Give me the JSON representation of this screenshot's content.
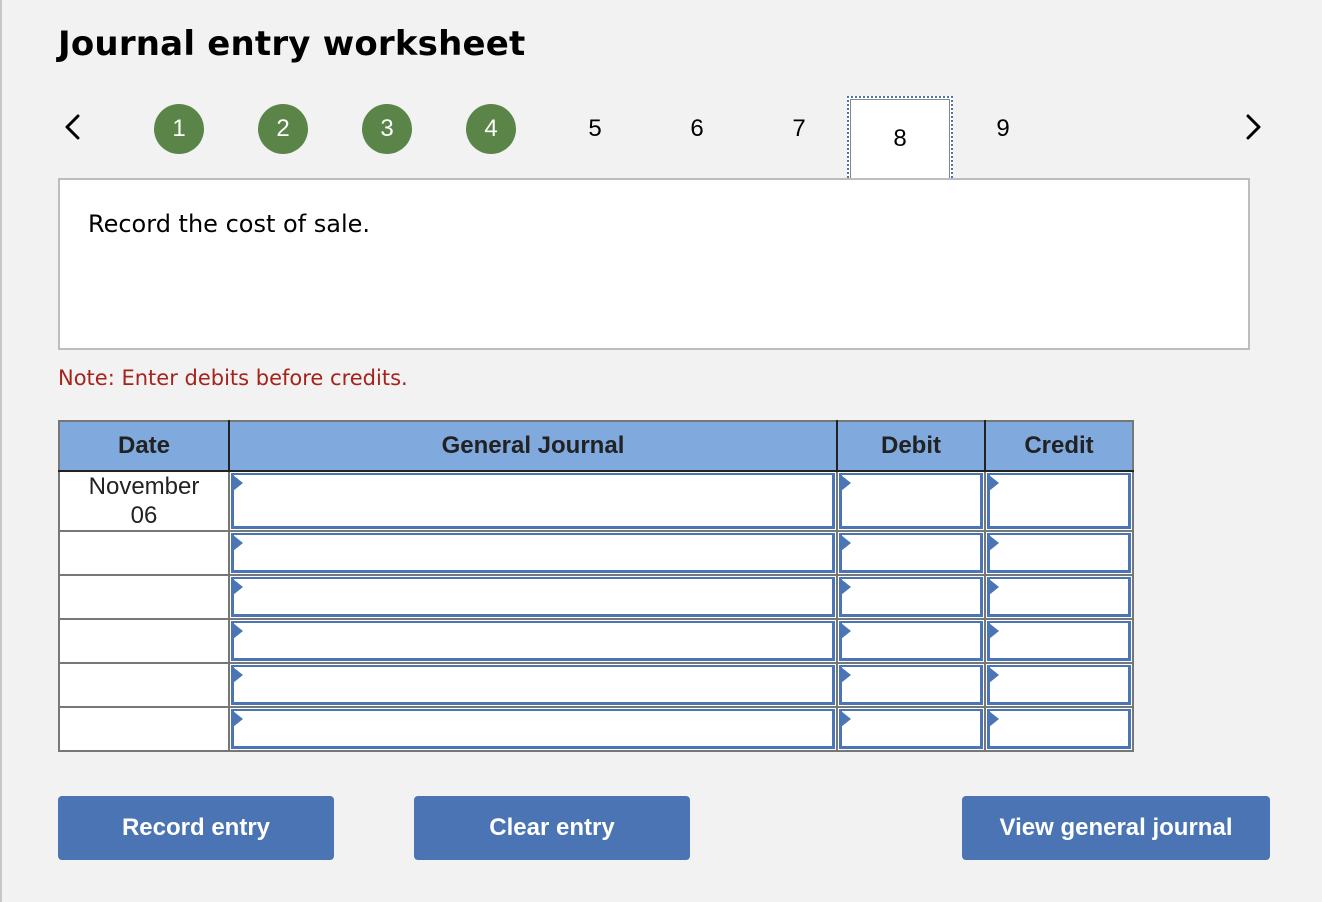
{
  "header": {
    "title": "Journal entry worksheet"
  },
  "navigation": {
    "prev_icon": "chevron-left-icon",
    "next_icon": "chevron-right-icon",
    "steps": [
      {
        "label": "1",
        "state": "completed"
      },
      {
        "label": "2",
        "state": "completed"
      },
      {
        "label": "3",
        "state": "completed"
      },
      {
        "label": "4",
        "state": "completed"
      },
      {
        "label": "5",
        "state": "pending"
      },
      {
        "label": "6",
        "state": "pending"
      },
      {
        "label": "7",
        "state": "pending"
      },
      {
        "label": "8",
        "state": "current"
      },
      {
        "label": "9",
        "state": "pending"
      }
    ]
  },
  "prompt": {
    "text": "Record the cost of sale."
  },
  "note": {
    "text": "Note: Enter debits before credits."
  },
  "journal": {
    "columns": [
      "Date",
      "General Journal",
      "Debit",
      "Credit"
    ],
    "rows": [
      {
        "date_line1": "November",
        "date_line2": "06",
        "account": "",
        "debit": "",
        "credit": ""
      },
      {
        "date_line1": "",
        "date_line2": "",
        "account": "",
        "debit": "",
        "credit": ""
      },
      {
        "date_line1": "",
        "date_line2": "",
        "account": "",
        "debit": "",
        "credit": ""
      },
      {
        "date_line1": "",
        "date_line2": "",
        "account": "",
        "debit": "",
        "credit": ""
      },
      {
        "date_line1": "",
        "date_line2": "",
        "account": "",
        "debit": "",
        "credit": ""
      },
      {
        "date_line1": "",
        "date_line2": "",
        "account": "",
        "debit": "",
        "credit": ""
      }
    ]
  },
  "buttons": {
    "record": "Record entry",
    "clear": "Clear entry",
    "view": "View general journal"
  },
  "colors": {
    "completed_step": "#5a8448",
    "header_fill": "#80a9de",
    "button_fill": "#4a74b3",
    "note_text": "#a6231c",
    "input_border": "#4a76b5"
  }
}
